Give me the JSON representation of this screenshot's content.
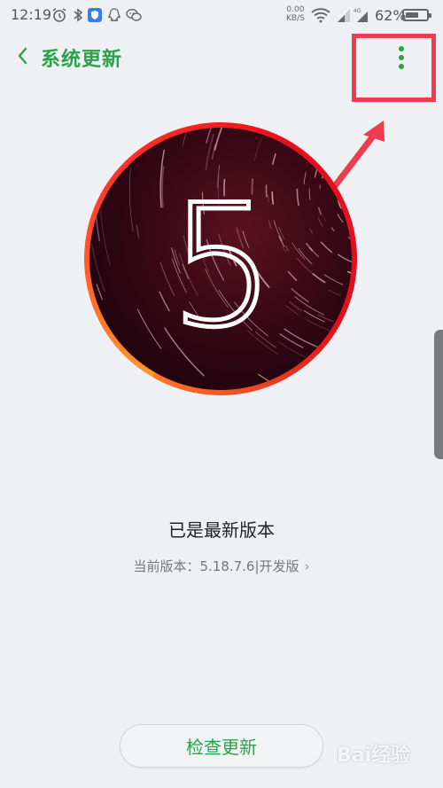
{
  "status_bar": {
    "time": "12:19",
    "net_speed_value": "0.00",
    "net_speed_unit": "KB/S",
    "battery_percent": "62%",
    "battery_level": 0.62,
    "icons": [
      "alarm-icon",
      "bluetooth-icon",
      "shield-app-icon",
      "qq-icon",
      "wechat-icon",
      "wifi-icon",
      "signal-icon",
      "signal-4g-icon",
      "battery-icon"
    ]
  },
  "header": {
    "title": "系统更新",
    "back_icon": "chevron-left-icon",
    "more_icon": "more-vertical-icon"
  },
  "version_badge": {
    "major": "5"
  },
  "status": {
    "message": "已是最新版本",
    "version_label": "当前版本：5.18.7.6|开发版",
    "chevron": "›"
  },
  "actions": {
    "check_update_label": "检查更新"
  },
  "watermark": "Bai经验",
  "colors": {
    "accent_green": "#2aa24a",
    "annotation_red": "#ee3c4f",
    "background": "#eef0f4"
  }
}
